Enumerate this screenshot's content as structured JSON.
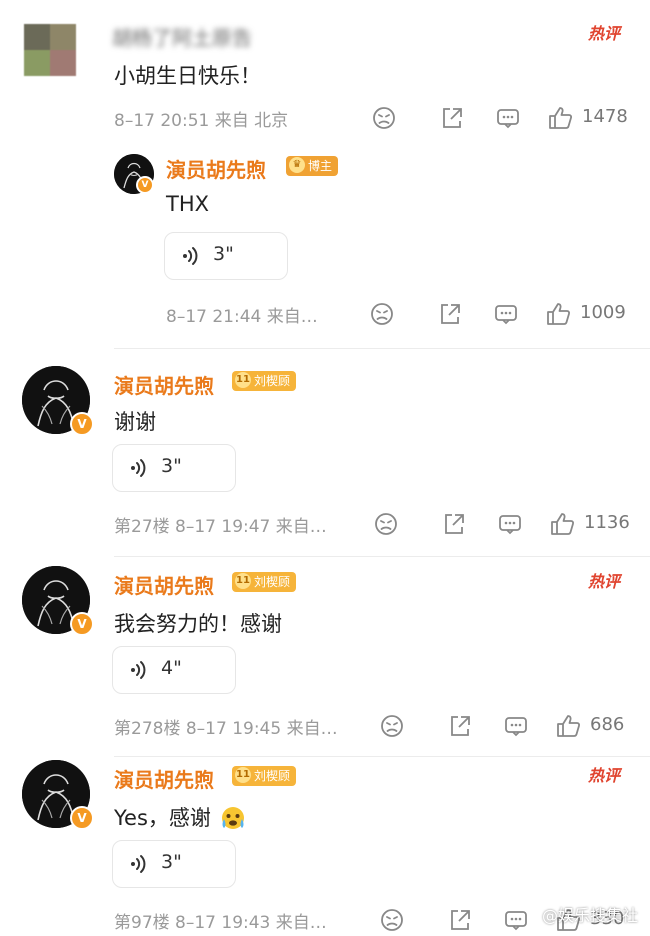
{
  "top_comment": {
    "username_blurred": "胡杨了阿土原告",
    "content": "小胡生日快乐！",
    "meta": "8–17 20:51 来自 北京",
    "likes": "1478"
  },
  "reply": {
    "username": "演员胡先煦",
    "badge": "博主",
    "content": "THX",
    "voice_duration": "3\"",
    "meta": "8–17 21:44 来自…",
    "likes": "1009"
  },
  "comments": [
    {
      "username": "演员胡先煦",
      "badge": "刘楔顾",
      "content": "谢谢",
      "voice_duration": "3\"",
      "meta": "第27楼 8–17 19:47 来自…",
      "likes": "1136",
      "hot": false
    },
    {
      "username": "演员胡先煦",
      "badge": "刘楔顾",
      "content": "我会努力的！感谢",
      "voice_duration": "4\"",
      "meta": "第278楼 8–17 19:45 来自…",
      "likes": "686",
      "hot": true
    },
    {
      "username": "演员胡先煦",
      "badge": "刘楔顾",
      "content": "Yes，感谢",
      "voice_duration": "3\"",
      "meta": "第97楼 8–17 19:43 来自…",
      "likes": "330",
      "hot": true
    }
  ],
  "hot_label": "热评",
  "verified_mark": "V",
  "watermark": "@娱乐搜集社",
  "colors": {
    "username": "#ea7a1b",
    "badge": "#f6b43a",
    "hot": "#e0442f",
    "meta": "#9a9a9a"
  }
}
